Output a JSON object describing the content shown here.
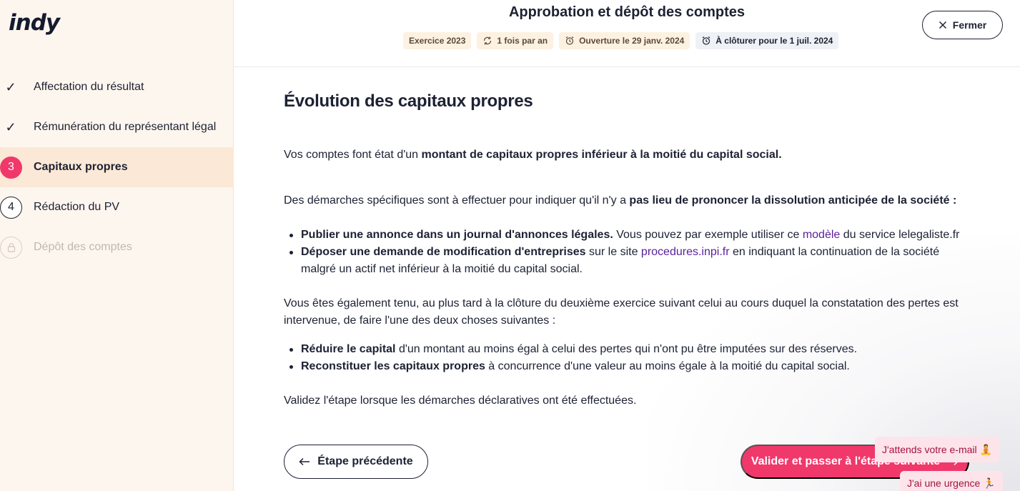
{
  "brand": {
    "logo": "indy"
  },
  "steps": [
    {
      "label": "Affectation du résultat",
      "state": "done",
      "marker": "✓"
    },
    {
      "label": "Rémunération du représentant légal",
      "state": "done",
      "marker": "✓"
    },
    {
      "label": "Capitaux propres",
      "state": "current",
      "marker": "3"
    },
    {
      "label": "Rédaction du PV",
      "state": "todo",
      "marker": "4"
    },
    {
      "label": "Dépôt des comptes",
      "state": "locked",
      "marker": "lock-icon"
    }
  ],
  "header": {
    "title": "Approbation et dépôt des comptes",
    "badges": {
      "exercice": "Exercice 2023",
      "frequency": "1 fois par an",
      "opening": "Ouverture le 29 janv. 2024",
      "closing": "À clôturer pour le 1 juil. 2024"
    },
    "close_label": "Fermer"
  },
  "main": {
    "heading": "Évolution des capitaux propres",
    "p1_pre": "Vos comptes font état d'un ",
    "p1_bold": "montant de capitaux propres inférieur à la moitié du capital social.",
    "p2_pre": "Des démarches spécifiques sont à effectuer pour indiquer qu'il n'y a ",
    "p2_bold": "pas lieu de prononcer la dissolution anticipée de la société :",
    "list1": [
      {
        "bold": "Publier une annonce dans un journal d'annonces légales.",
        "pre": " Vous pouvez par exemple utiliser ce ",
        "link": "modèle",
        "post": " du service lelegaliste.fr"
      },
      {
        "bold": "Déposer une demande de modification d'entreprises",
        "pre": " sur le site ",
        "link": "procedures.inpi.fr",
        "post": " en indiquant la continuation de la société malgré un actif net inférieur à la moitié du capital social."
      }
    ],
    "p3": "Vous êtes également tenu, au plus tard à la clôture du deuxième exercice suivant celui au cours duquel la constatation des pertes est intervenue, de faire l'une des deux choses suivantes :",
    "list2": [
      {
        "bold": "Réduire le capital",
        "post": " d'un montant au moins égal à celui des pertes qui n'ont pu être imputées sur des réserves."
      },
      {
        "bold": "Reconstituer les capitaux propres",
        "post": " à concurrence d'une valeur au moins égale à la moitié du capital social."
      }
    ],
    "p4": "Validez l'étape lorsque les démarches déclaratives ont été effectuées."
  },
  "footer": {
    "prev_label": "Étape précédente",
    "next_label": "Valider et passer à l'étape suivante"
  },
  "chips": {
    "email": "J'attends votre e-mail 🧘",
    "urgent": "J'ai une urgence 🏃"
  },
  "colors": {
    "accent": "#f0386b",
    "sidebar_bg": "#fdf6ee",
    "link": "#5a1f9c"
  }
}
